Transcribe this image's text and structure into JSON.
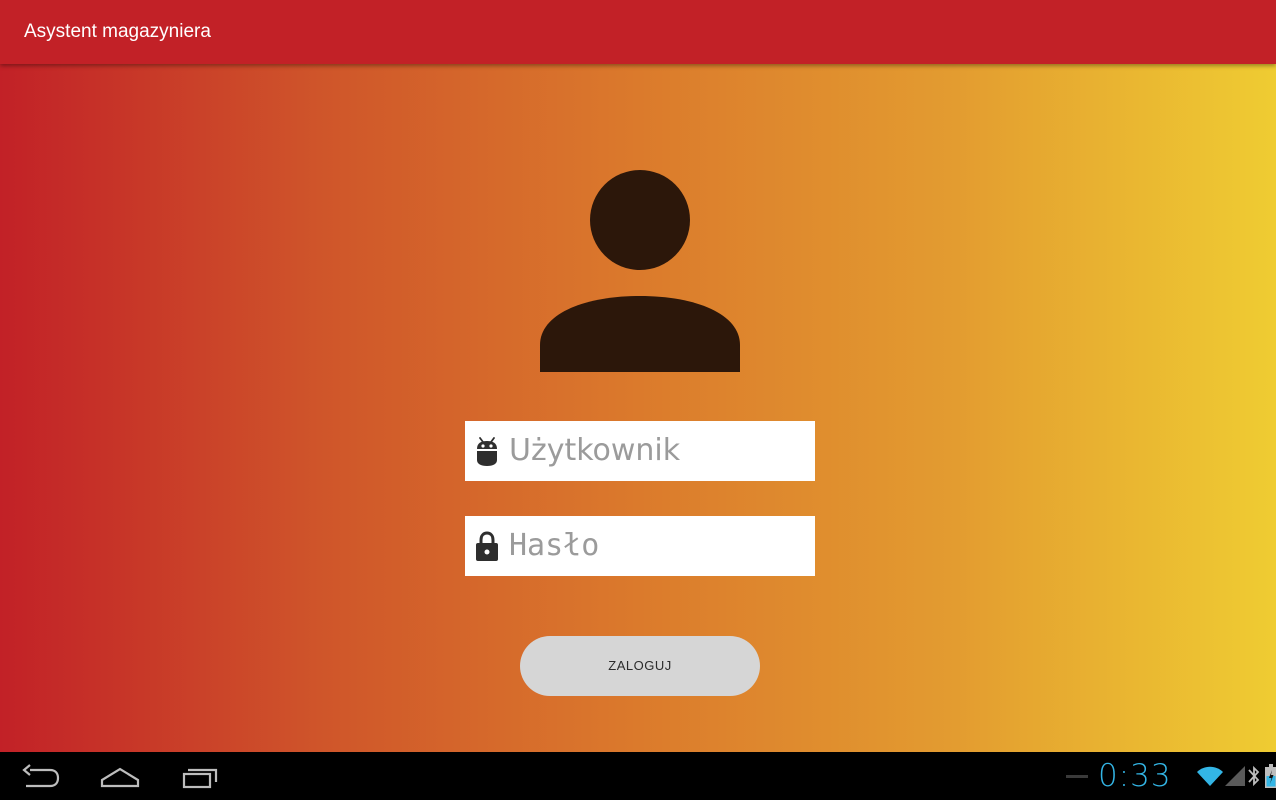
{
  "app_bar": {
    "title": "Asystent magazyniera",
    "color": "#c22127"
  },
  "background": {
    "gradient_colors": [
      "#c22127",
      "#db7a2c",
      "#efcc32"
    ]
  },
  "login_form": {
    "avatar_icon": "person-icon",
    "username": {
      "icon": "android-icon",
      "placeholder": "Użytkownik",
      "value": ""
    },
    "password": {
      "icon": "lock-icon",
      "placeholder": "Hasło",
      "value": ""
    },
    "login_button_label": "ZALOGUJ"
  },
  "system_bar": {
    "nav_buttons": [
      "back-icon",
      "home-icon",
      "recents-icon"
    ],
    "clock": "0:33",
    "status_icons": [
      "wifi-icon",
      "signal-icon",
      "bluetooth-icon",
      "battery-icon"
    ],
    "accent_color": "#33b5e5"
  }
}
